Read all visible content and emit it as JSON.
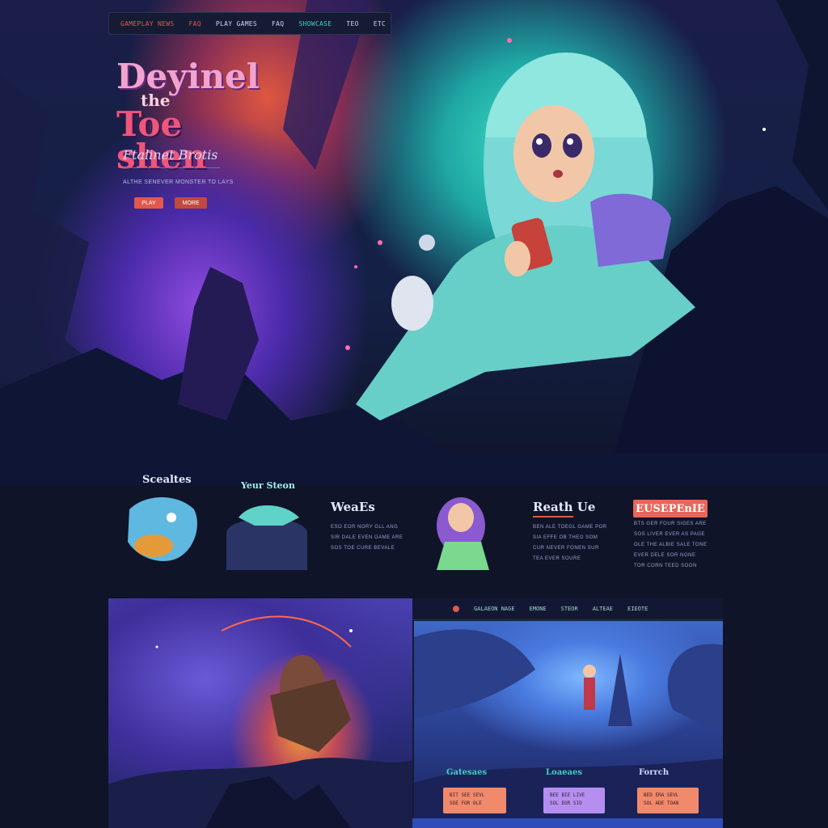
{
  "nav": {
    "items": [
      {
        "label": "GAMEPLAY NEWS",
        "color": "#e0584e"
      },
      {
        "label": "FAQ",
        "color": "#e0584e"
      },
      {
        "label": "PLAY GAMES",
        "color": "#d0d4ff"
      },
      {
        "label": "FAQ",
        "color": "#d0d4ff"
      },
      {
        "label": "SHOWCASE",
        "color": "#3fd3c5"
      },
      {
        "label": "TEO",
        "color": "#d0d4ff"
      },
      {
        "label": "ETC",
        "color": "#d0d4ff"
      }
    ]
  },
  "hero": {
    "title_line1": "Deyinel",
    "title_line2": "the",
    "title_line3": "Toe shen",
    "subtitle": "Ftalinet Brotis",
    "tagline": "ALTHE SENEVER MONSTER TO LAYS",
    "button_primary": "PLAY",
    "button_secondary": "MORE"
  },
  "features": {
    "col1_title": "Scealtes",
    "col2_title": "Yeur Steon",
    "col3_title": "WeaEs",
    "col3_text": "ESO EOR NORY GLL ANG\nSIR DALE EVEN GAME ARE\nSOS TOE CURE BEVALE",
    "col4_title": "Reath Ue",
    "col4_text": "BEN ALE TOEGL GAME POR\nSIA EFFE OB THEO SOM\nCUR NEVER FONEN SUR\nTEA EVER SOURE",
    "cta_label": "EUSEPEnIE",
    "col5_text": "BTS GER FOUR SIGES ARE\nSOS LIVER EVER AS PAGE\nOLE THE ALBIE SALE TONE\nEVER DELE SOR NONE\nTOR CORN TEED SOON"
  },
  "panel_right": {
    "nav": [
      "GALAEON NAGE",
      "EMONE",
      "STEOR",
      "ALTEAE",
      "EIEOTE"
    ],
    "labels": [
      {
        "text": "Gatesaes",
        "color": "#3fd3c5"
      },
      {
        "text": "Loaeaes",
        "color": "#3fd3c5"
      },
      {
        "text": "Forrch",
        "color": "#d0d4ff"
      }
    ],
    "cards": [
      {
        "text": "BIT SEE SEVL\nSOE FOR OLE",
        "color": "#f08a6a"
      },
      {
        "text": "BEE BIE LIVE\nSOL EOR SIO",
        "color": "#b58ff0"
      },
      {
        "text": "BED ERA SEVL\nSOL ADE TOAN",
        "color": "#f08a6a"
      }
    ]
  },
  "colors": {
    "accent": "#e0584e",
    "teal": "#3fd3c5",
    "background": "#0f1428"
  }
}
